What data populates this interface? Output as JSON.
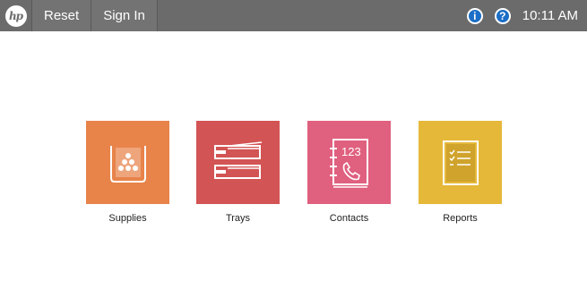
{
  "topbar": {
    "logo_text": "hp",
    "reset_label": "Reset",
    "signin_label": "Sign In",
    "info_glyph": "i",
    "help_glyph": "?",
    "time": "10:11 AM"
  },
  "apps": [
    {
      "label": "Supplies",
      "color": "#e8834a",
      "icon": "toner-cartridge-icon"
    },
    {
      "label": "Trays",
      "color": "#d35454",
      "icon": "paper-trays-icon"
    },
    {
      "label": "Contacts",
      "color": "#e0607f",
      "icon": "address-book-icon",
      "icon_text": "123"
    },
    {
      "label": "Reports",
      "color": "#e5b83a",
      "icon": "report-checklist-icon"
    }
  ]
}
